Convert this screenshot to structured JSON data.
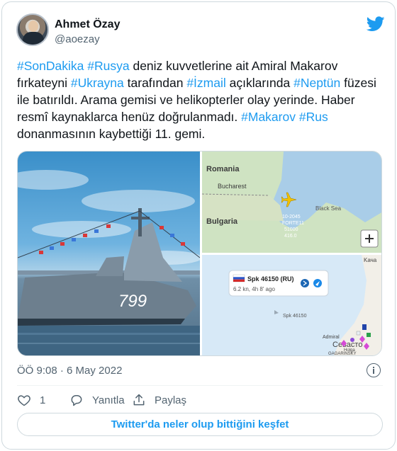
{
  "author": {
    "name": "Ahmet Özay",
    "handle": "@aoezay"
  },
  "tweet": {
    "segments": [
      {
        "text": "#SonDakika",
        "type": "tag"
      },
      {
        "text": " ",
        "type": "text"
      },
      {
        "text": "#Rusya",
        "type": "tag"
      },
      {
        "text": " deniz kuvvetlerine ait Amiral Makarov fırkateyni ",
        "type": "text"
      },
      {
        "text": "#Ukrayna",
        "type": "tag"
      },
      {
        "text": " tarafından ",
        "type": "text"
      },
      {
        "text": "#İzmail",
        "type": "tag"
      },
      {
        "text": " açıklarında ",
        "type": "text"
      },
      {
        "text": "#Neptün",
        "type": "tag"
      },
      {
        "text": " füzesi ile batırıldı. Arama gemisi ve helikopterler olay yerinde. Haber resmî kaynaklarca henüz doğrulanmadı. ",
        "type": "text"
      },
      {
        "text": "#Makarov",
        "type": "tag"
      },
      {
        "text": " ",
        "type": "text"
      },
      {
        "text": "#Rus",
        "type": "tag"
      },
      {
        "text": " donanmasının kaybettiği 11. gemi.",
        "type": "text"
      }
    ]
  },
  "media": {
    "ship_number": "799",
    "map1": {
      "labels": [
        "Romania",
        "Bucharest",
        "Bulgaria",
        "Black Sea"
      ],
      "flight": [
        "10-2045",
        "FORTE11",
        "51000",
        "416.0"
      ]
    },
    "map2": {
      "vessel_name": "Spk 46150 (RU)",
      "vessel_info": "6.2 kn, 4h 8' ago",
      "vessel_label": "Spk 46150",
      "place_labels": [
        "Kача",
        "Admiral",
        "Севасто",
        "GAGARINSKY",
        "Holga"
      ]
    }
  },
  "timestamp": "ÖÖ 9:08 · 6 May 2022",
  "actions": {
    "likes": "1",
    "reply_label": "Yanıtla",
    "share_label": "Paylaş"
  },
  "explore_label": "Twitter'da neler olup bittiğini keşfet",
  "colors": {
    "accent": "#1d9bf0",
    "text": "#0f1419",
    "muted": "#536471"
  }
}
